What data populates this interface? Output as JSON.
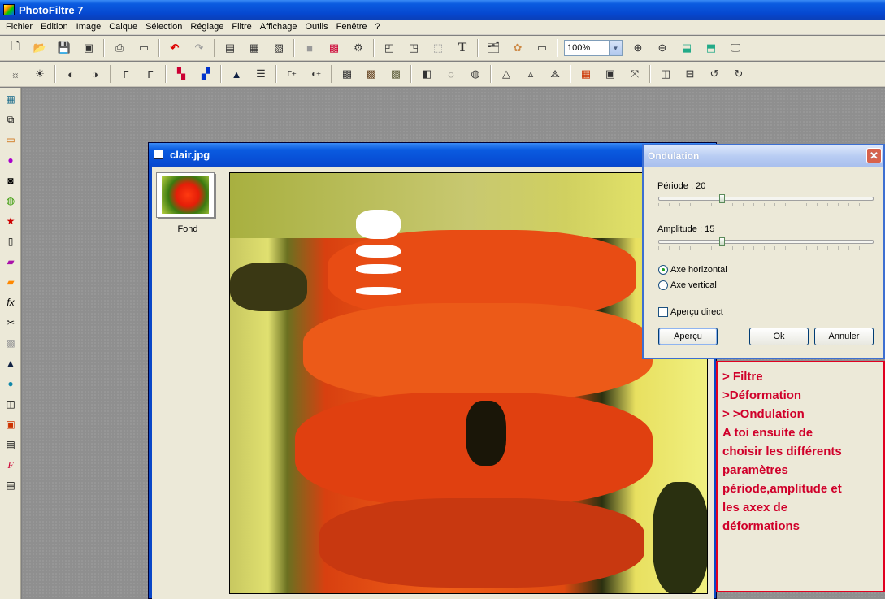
{
  "app": {
    "title": "PhotoFiltre 7"
  },
  "menu": [
    "Fichier",
    "Edition",
    "Image",
    "Calque",
    "Sélection",
    "Réglage",
    "Filtre",
    "Affichage",
    "Outils",
    "Fenêtre",
    "?"
  ],
  "toolbar": {
    "zoom_value": "100%"
  },
  "document": {
    "title": "clair.jpg",
    "layer_label": "Fond"
  },
  "dialog": {
    "title": "Ondulation",
    "period_label": "Période : 20",
    "period_value": 20,
    "amplitude_label": "Amplitude : 15",
    "amplitude_value": 15,
    "axis_h_label": "Axe horizontal",
    "axis_v_label": "Axe vertical",
    "axis_selected": "horizontal",
    "preview_direct_label": "Aperçu direct",
    "preview_direct_checked": false,
    "preview_button": "Aperçu",
    "ok_button": "Ok",
    "cancel_button": "Annuler",
    "close_glyph": "✕"
  },
  "note": {
    "lines": [
      "> Filtre",
      ">Déformation",
      "> >Ondulation",
      "A toi ensuite de",
      "choisir les différents",
      "paramètres",
      "période,amplitude et",
      "les axex de",
      "déformations"
    ]
  },
  "colors": {
    "accent": "#0a5be0",
    "note_red": "#d0002a"
  }
}
